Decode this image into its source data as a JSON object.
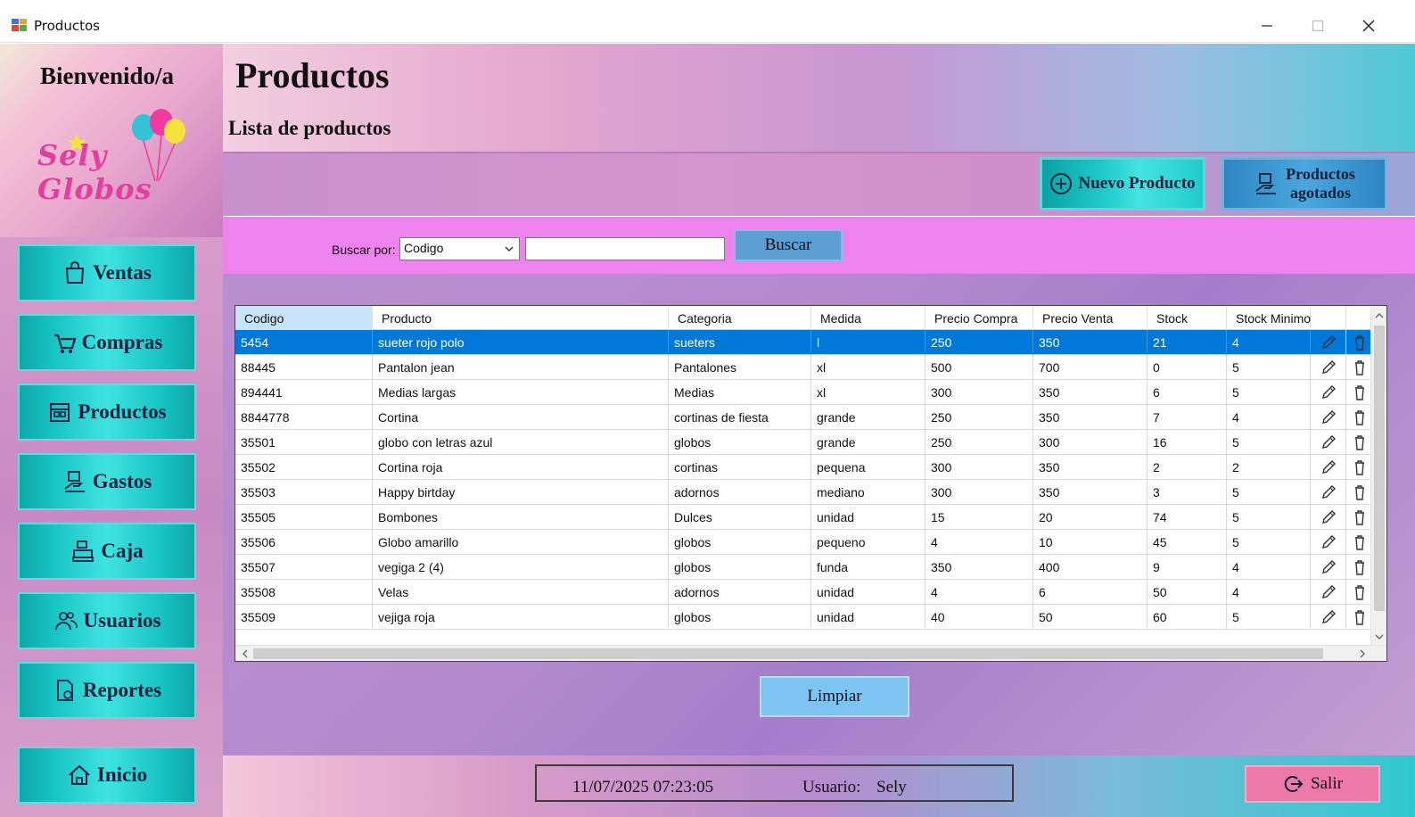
{
  "window": {
    "title": "Productos",
    "min_icon": "minimize-icon",
    "max_icon": "maximize-icon",
    "close_icon": "close-icon"
  },
  "sidebar": {
    "welcome": "Bienvenido/a",
    "logo": "Sely Globos",
    "items": [
      {
        "label": "Ventas",
        "icon": "shopping-bag-icon"
      },
      {
        "label": "Compras",
        "icon": "cart-icon"
      },
      {
        "label": "Productos",
        "icon": "box-icon"
      },
      {
        "label": "Gastos",
        "icon": "expense-icon"
      },
      {
        "label": "Caja",
        "icon": "cash-register-icon"
      },
      {
        "label": "Usuarios",
        "icon": "users-icon"
      },
      {
        "label": "Reportes",
        "icon": "report-icon"
      },
      {
        "label": "Inicio",
        "icon": "home-icon"
      }
    ]
  },
  "header": {
    "title": "Productos",
    "subtitle": "Lista de productos"
  },
  "actions": {
    "nuevo": "Nuevo Producto",
    "agotados_line1": "Productos",
    "agotados_line2": "agotados"
  },
  "search": {
    "label": "Buscar por:",
    "field": "Codigo",
    "value": "",
    "button": "Buscar"
  },
  "table": {
    "columns": [
      "Codigo",
      "Producto",
      "Categoria",
      "Medida",
      "Precio Compra",
      "Precio Venta",
      "Stock",
      "Stock Minimo"
    ],
    "rows": [
      [
        "5454",
        "sueter rojo polo",
        "sueters",
        "l",
        "250",
        "350",
        "21",
        "4"
      ],
      [
        "88445",
        "Pantalon jean",
        "Pantalones",
        "xl",
        "500",
        "700",
        "0",
        "5"
      ],
      [
        "894441",
        "Medias largas",
        "Medias",
        "xl",
        "300",
        "350",
        "6",
        "5"
      ],
      [
        "8844778",
        "Cortina",
        "cortinas de fiesta",
        "grande",
        "250",
        "350",
        "7",
        "4"
      ],
      [
        "35501",
        "globo con letras azul",
        "globos",
        "grande",
        "250",
        "300",
        "16",
        "5"
      ],
      [
        "35502",
        "Cortina roja",
        "cortinas",
        "pequena",
        "300",
        "350",
        "2",
        "2"
      ],
      [
        "35503",
        "Happy birtday",
        "adornos",
        "mediano",
        "300",
        "350",
        "3",
        "5"
      ],
      [
        "35505",
        "Bombones",
        "Dulces",
        "unidad",
        "15",
        "20",
        "74",
        "5"
      ],
      [
        "35506",
        "Globo amarillo",
        "globos",
        "pequeno",
        "4",
        "10",
        "45",
        "5"
      ],
      [
        "35507",
        "vegiga 2 (4)",
        "globos",
        "funda",
        "350",
        "400",
        "9",
        "4"
      ],
      [
        "35508",
        "Velas",
        "adornos",
        "unidad",
        "4",
        "6",
        "50",
        "4"
      ],
      [
        "35509",
        "vejiga roja",
        "globos",
        "unidad",
        "40",
        "50",
        "60",
        "5"
      ]
    ]
  },
  "limpiar": "Limpiar",
  "footer": {
    "datetime": "11/07/2025 07:23:05",
    "user_label": "Usuario:",
    "user_name": "Sely",
    "salir": "Salir"
  },
  "colors": {
    "nav_button": "#1fc6c7",
    "search_band": "#ee82ee",
    "selected_row": "#0078d7",
    "buscar_button": "#5d9fd3",
    "salir_button": "#ec79a8"
  }
}
